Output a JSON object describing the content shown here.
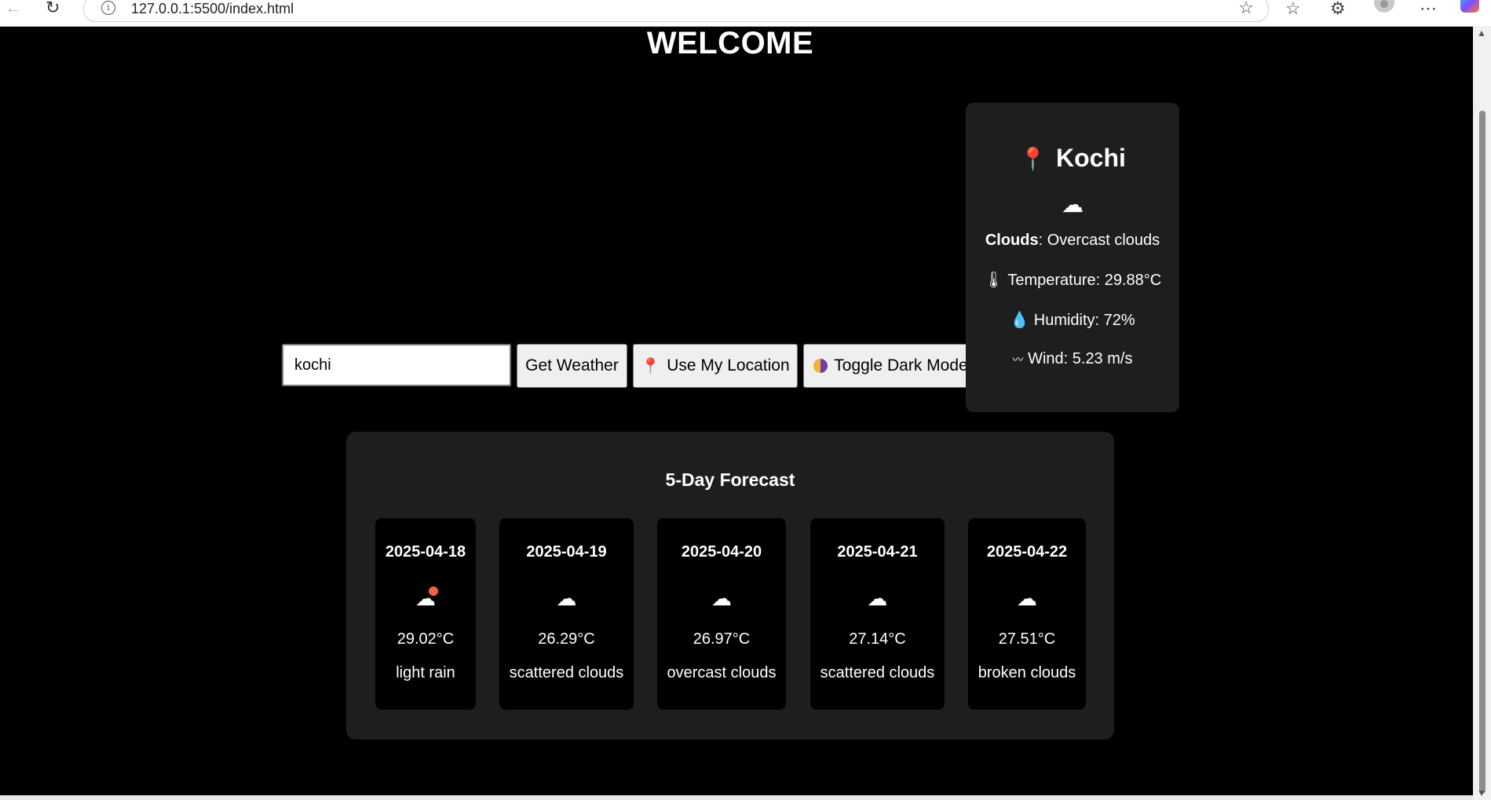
{
  "browser": {
    "url": "127.0.0.1:5500/index.html"
  },
  "page": {
    "title": "WELCOME"
  },
  "search": {
    "value": "kochi",
    "get_weather_label": "Get Weather",
    "use_location_label": "Use My Location",
    "toggle_dark_label": "Toggle Dark Mode"
  },
  "current": {
    "city": "Kochi",
    "condition_main": "Clouds",
    "condition_desc": ": Overcast clouds",
    "temperature": "Temperature: 29.88°C",
    "humidity": "Humidity: 72%",
    "wind": "Wind: 5.23 m/s",
    "icon": "overcast-cloud-icon"
  },
  "forecast": {
    "title": "5-Day Forecast",
    "days": [
      {
        "date": "2025-04-18",
        "temp": "29.02°C",
        "desc": "light rain",
        "icon": "light-rain-icon"
      },
      {
        "date": "2025-04-19",
        "temp": "26.29°C",
        "desc": "scattered clouds",
        "icon": "cloud-icon"
      },
      {
        "date": "2025-04-20",
        "temp": "26.97°C",
        "desc": "overcast clouds",
        "icon": "overcast-cloud-icon"
      },
      {
        "date": "2025-04-21",
        "temp": "27.14°C",
        "desc": "scattered clouds",
        "icon": "cloud-icon"
      },
      {
        "date": "2025-04-22",
        "temp": "27.51°C",
        "desc": "broken clouds",
        "icon": "broken-cloud-icon"
      }
    ]
  }
}
